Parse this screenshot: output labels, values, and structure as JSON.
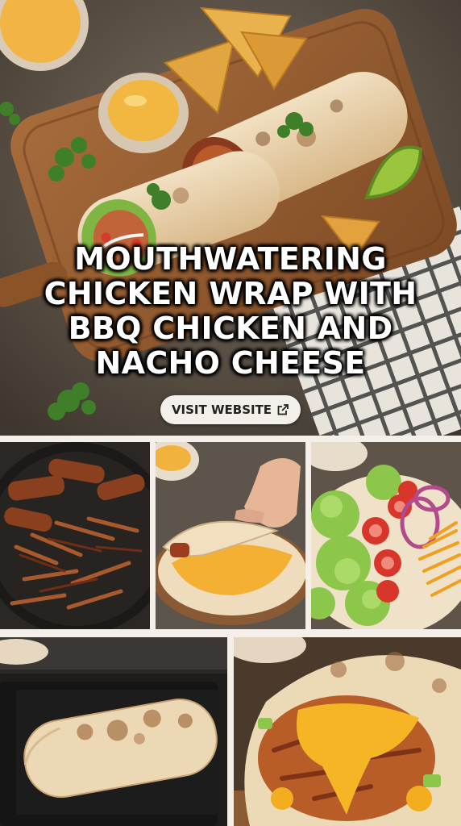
{
  "hero": {
    "title_lines": [
      "MOUTHWATERING",
      "CHICKEN WRAP WITH",
      "BBQ CHICKEN AND",
      "NACHO CHEESE"
    ],
    "cta": {
      "label": "VISIT WEBSITE",
      "icon": "external-link-icon"
    }
  },
  "steps": [
    {
      "photo": "shredded-bbq-chicken-in-skillet"
    },
    {
      "photo": "folding-tortilla-with-cheese-sauce"
    },
    {
      "photo": "lettuce-tomato-onion-cheddar"
    },
    {
      "photo": "wrap-toasting-on-griddle"
    },
    {
      "photo": "cut-wrap-with-melted-cheese"
    }
  ],
  "colors": {
    "background": "#f4efe8",
    "cta_background": "#f3efe9",
    "title_text": "#ffffff"
  }
}
